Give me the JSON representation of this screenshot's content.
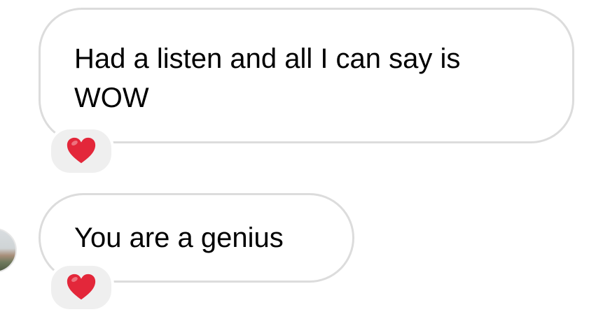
{
  "messages": [
    {
      "text": "Had a listen and all I can say is WOW",
      "reaction": "heart-emoji"
    },
    {
      "text": "You are a genius",
      "reaction": "heart-emoji"
    }
  ],
  "colors": {
    "bubble_border": "#dcdcdc",
    "reaction_background": "#efefef",
    "heart": "#e3273a"
  }
}
